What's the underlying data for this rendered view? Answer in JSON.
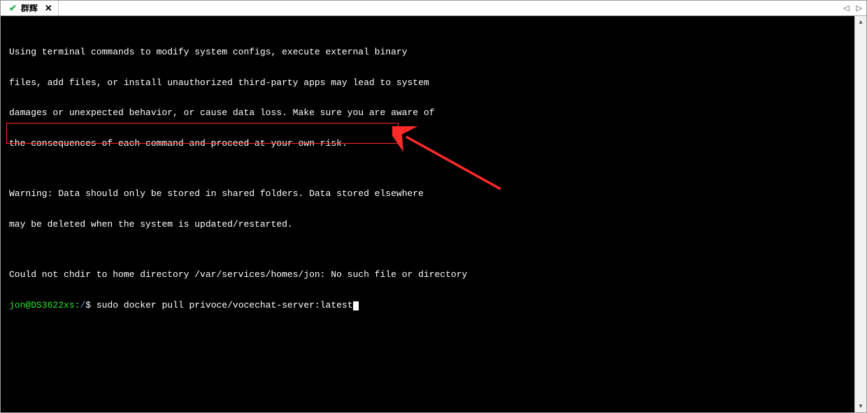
{
  "tab": {
    "title": "群辉"
  },
  "terminal": {
    "warning_lines": [
      "Using terminal commands to modify system configs, execute external binary",
      "files, add files, or install unauthorized third-party apps may lead to system",
      "damages or unexpected behavior, or cause data loss. Make sure you are aware of",
      "the consequences of each command and proceed at your own risk.",
      "",
      "Warning: Data should only be stored in shared folders. Data stored elsewhere",
      "may be deleted when the system is updated/restarted.",
      "",
      "Could not chdir to home directory /var/services/homes/jon: No such file or directory"
    ],
    "prompt": {
      "user_host": "jon@DS3622xs",
      "separator": ":",
      "path": "/",
      "symbol": "$"
    },
    "command": "sudo docker pull privoce/vocechat-server:latest"
  },
  "annotation": {
    "highlight_color": "#ff2a2a"
  }
}
